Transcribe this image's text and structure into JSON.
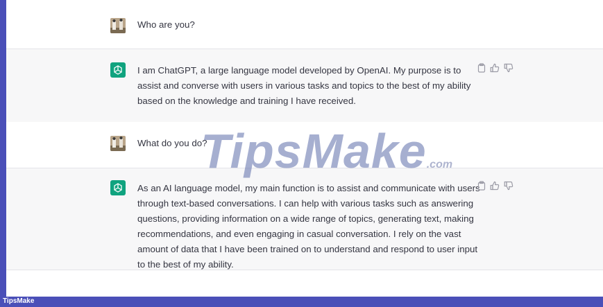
{
  "conversation": {
    "messages": [
      {
        "role": "user",
        "text": "Who are you?"
      },
      {
        "role": "assistant",
        "text": "I am ChatGPT, a large language model developed by OpenAI. My purpose is to assist and converse with users in various tasks and topics to the best of my ability based on the knowledge and training I have received."
      },
      {
        "role": "user",
        "text": "What do you do?"
      },
      {
        "role": "assistant",
        "text": "As an AI language model, my main function is to assist and communicate with users through text-based conversations. I can help with various tasks such as answering questions, providing information on a wide range of topics, generating text, making recommendations, and even engaging in casual conversation. I rely on the vast amount of data that I have been trained on to understand and respond to user input to the best of my ability."
      }
    ]
  },
  "watermark": {
    "main": "TipsMake",
    "suffix": ".com"
  },
  "footer": {
    "label": "TipsMake"
  },
  "colors": {
    "assistant_avatar": "#10a37f",
    "footer_bar": "#4a4fb8",
    "assistant_bg": "#f7f7f8"
  },
  "icons": {
    "copy": "clipboard-icon",
    "like": "thumbs-up-icon",
    "dislike": "thumbs-down-icon"
  }
}
